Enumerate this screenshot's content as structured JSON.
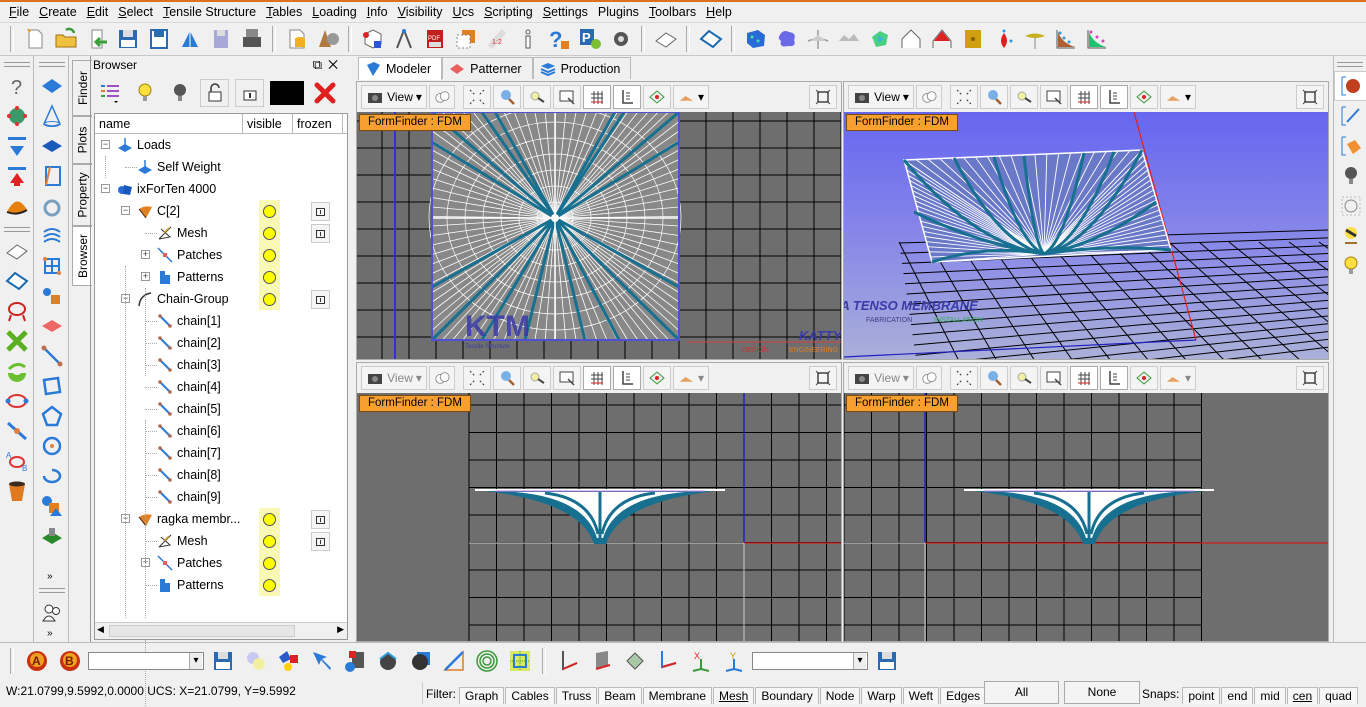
{
  "menubar": {
    "items": [
      {
        "label": "File",
        "ul": "F",
        "rest": "ile"
      },
      {
        "label": "Create",
        "ul": "C",
        "rest": "reate"
      },
      {
        "label": "Edit",
        "ul": "E",
        "rest": "dit"
      },
      {
        "label": "Select",
        "ul": "S",
        "rest": "elect"
      },
      {
        "label": "Tensile Structure",
        "ul": "T",
        "rest": "ensile Structure"
      },
      {
        "label": "Tables",
        "ul": "T",
        "rest": "ables"
      },
      {
        "label": "Loading",
        "ul": "L",
        "rest": "oading"
      },
      {
        "label": "Info",
        "ul": "I",
        "rest": "nfo"
      },
      {
        "label": "Visibility",
        "ul": "V",
        "rest": "isibility"
      },
      {
        "label": "Ucs",
        "ul": "U",
        "rest": "cs"
      },
      {
        "label": "Scripting",
        "ul": "S",
        "rest": "cripting"
      },
      {
        "label": "Settings",
        "ul": "S",
        "rest": "ettings"
      },
      {
        "label": "Plugins",
        "ul": "",
        "rest": "Plugins"
      },
      {
        "label": "Toolbars",
        "ul": "T",
        "rest": "oolbars"
      },
      {
        "label": "Help",
        "ul": "H",
        "rest": "elp"
      }
    ]
  },
  "main_toolbar": {
    "groups": [
      [
        "new-file-icon",
        "open-folder-icon",
        "import-icon",
        "save-icon",
        "save-as-icon",
        "export-dxf-icon",
        "save-copy-icon",
        "print-icon"
      ],
      [
        "database-icon",
        "material-icon"
      ],
      [
        "cube-select-icon",
        "compass-icon",
        "pdf-icon",
        "layers-icon",
        "scale-icon",
        "info-icon",
        "help-icon",
        "plugin-p-icon",
        "settings-lock-icon"
      ],
      [
        "sheet-icon"
      ],
      [
        "sheet-blue-icon"
      ],
      [
        "blue-mesh-icon",
        "blob-icon",
        "tent-grey-icon",
        "tent-double-icon",
        "green-shape-icon",
        "tent-white-icon",
        "tent-red-icon",
        "gold-panel-icon",
        "red-drop-icon",
        "umbrella-icon",
        "chart-brown-icon",
        "chart-green-icon"
      ]
    ]
  },
  "browser": {
    "title": "Browser",
    "color_swatch": "#000000",
    "side_tabs": [
      "Finder",
      "Plots",
      "Property",
      "Browser"
    ],
    "columns": [
      "name",
      "visible",
      "frozen"
    ],
    "rows": [
      {
        "label": "Loads",
        "level": 0,
        "expander": "-",
        "icon": "load-icon",
        "visible": false,
        "frozen": false
      },
      {
        "label": "Self Weight",
        "level": 1,
        "expander": "",
        "icon": "load-icon",
        "visible": false,
        "frozen": false
      },
      {
        "label": "ixForTen 4000",
        "level": 0,
        "expander": "-",
        "icon": "model-icon",
        "visible": false,
        "frozen": false
      },
      {
        "label": "C[2]",
        "level": 1,
        "expander": "-",
        "icon": "membrane-cone-icon",
        "visible": true,
        "frozen": true
      },
      {
        "label": "Mesh",
        "level": 2,
        "expander": "",
        "icon": "mesh-icon",
        "visible": true,
        "frozen": true
      },
      {
        "label": "Patches",
        "level": 2,
        "expander": "+",
        "icon": "patches-icon",
        "visible": true,
        "frozen": false
      },
      {
        "label": "Patterns",
        "level": 2,
        "expander": "+",
        "icon": "patterns-icon",
        "visible": true,
        "frozen": false
      },
      {
        "label": "Chain-Group",
        "level": 1,
        "expander": "-",
        "icon": "chain-group-icon",
        "visible": true,
        "frozen": true
      },
      {
        "label": "chain[1]",
        "level": 2,
        "expander": "",
        "icon": "chain-icon",
        "visible": false,
        "frozen": false
      },
      {
        "label": "chain[2]",
        "level": 2,
        "expander": "",
        "icon": "chain-icon",
        "visible": false,
        "frozen": false
      },
      {
        "label": "chain[3]",
        "level": 2,
        "expander": "",
        "icon": "chain-icon",
        "visible": false,
        "frozen": false
      },
      {
        "label": "chain[4]",
        "level": 2,
        "expander": "",
        "icon": "chain-icon",
        "visible": false,
        "frozen": false
      },
      {
        "label": "chain[5]",
        "level": 2,
        "expander": "",
        "icon": "chain-icon",
        "visible": false,
        "frozen": false
      },
      {
        "label": "chain[6]",
        "level": 2,
        "expander": "",
        "icon": "chain-icon",
        "visible": false,
        "frozen": false
      },
      {
        "label": "chain[7]",
        "level": 2,
        "expander": "",
        "icon": "chain-icon",
        "visible": false,
        "frozen": false
      },
      {
        "label": "chain[8]",
        "level": 2,
        "expander": "",
        "icon": "chain-icon",
        "visible": false,
        "frozen": false
      },
      {
        "label": "chain[9]",
        "level": 2,
        "expander": "",
        "icon": "chain-icon",
        "visible": false,
        "frozen": false
      },
      {
        "label": "ragka membr...",
        "level": 1,
        "expander": "-",
        "icon": "membrane-cone-icon",
        "visible": true,
        "frozen": true
      },
      {
        "label": "Mesh",
        "level": 2,
        "expander": "",
        "icon": "mesh-icon",
        "visible": true,
        "frozen": true
      },
      {
        "label": "Patches",
        "level": 2,
        "expander": "+",
        "icon": "patches-icon",
        "visible": true,
        "frozen": false
      },
      {
        "label": "Patterns",
        "level": 2,
        "expander": "",
        "icon": "patterns-icon",
        "visible": true,
        "frozen": false
      }
    ]
  },
  "tabs": [
    {
      "label": "Modeler",
      "icon": "modeler-icon",
      "active": true
    },
    {
      "label": "Patterner",
      "icon": "patterner-icon",
      "active": false
    },
    {
      "label": "Production",
      "icon": "production-icon",
      "active": false
    }
  ],
  "viewports": [
    {
      "label": "FormFinder : FDM",
      "view_button": "View",
      "view": "top",
      "background": "#6e6e6e"
    },
    {
      "label": "FormFinder : FDM",
      "view_button": "View",
      "view": "perspective",
      "background": "#6c6cf0"
    },
    {
      "label": "FormFinder : FDM",
      "view_button": "View",
      "view": "front",
      "background": "#6e6e6e"
    },
    {
      "label": "FormFinder : FDM",
      "view_button": "View",
      "view": "side",
      "background": "#6e6e6e"
    }
  ],
  "watermark": {
    "logo": "KTM",
    "logo_sub": "Tensile Structure",
    "company": "KATTYA TENSO MEMBRANE",
    "services": [
      {
        "label": "DESIGN",
        "color": "#d03030"
      },
      {
        "label": "ENGINEERING",
        "color": "#e08020"
      },
      {
        "label": "FABRICATION",
        "color": "#404080"
      },
      {
        "label": "INSTALLATION",
        "color": "#30b050"
      }
    ]
  },
  "bottom_toolbar": {
    "combo1_value": "",
    "combo2_value": ""
  },
  "status": {
    "coords": "W:21.0799,9.5992,0.0000   UCS: X=21.0799, Y=9.5992",
    "filter_label": "Filter:",
    "filters": [
      "Graph",
      "Cables",
      "Truss",
      "Beam",
      "Membrane",
      "Mesh",
      "Boundary",
      "Node",
      "Warp",
      "Weft",
      "Edges"
    ],
    "all_label": "All",
    "none_label": "None",
    "snaps_label": "Snaps:",
    "snaps": [
      "point",
      "end",
      "mid",
      "cen",
      "quad"
    ]
  },
  "colors": {
    "accent_orange": "#f7a030",
    "mesh_cable": "#17708f",
    "viewport_grey": "#6e6e6e",
    "perspective_blue": "#6c6cf0"
  }
}
